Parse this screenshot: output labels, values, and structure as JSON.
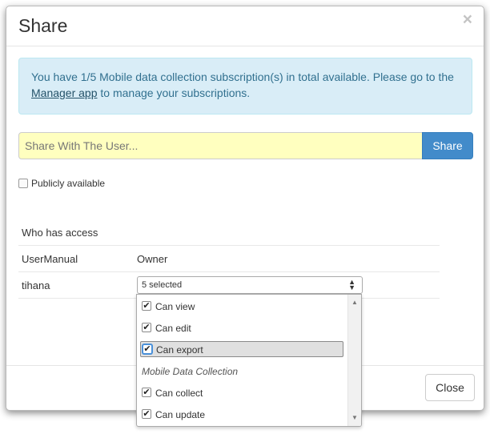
{
  "dialog": {
    "title": "Share",
    "close_symbol": "×"
  },
  "alert": {
    "text_before": "You have 1/5 Mobile data collection subscription(s) in total available. Please go to the ",
    "link": "Manager app",
    "text_after": " to manage your subscriptions."
  },
  "share": {
    "placeholder": "Share With The User...",
    "button_label": "Share"
  },
  "public": {
    "label": "Publicly available",
    "checked": false
  },
  "access": {
    "header": "Who has access",
    "rows": [
      {
        "user": "UserManual",
        "role": "Owner"
      },
      {
        "user": "tihana",
        "select_value": "5 selected"
      }
    ]
  },
  "dropdown": {
    "items": [
      {
        "label": "Can view",
        "checked": true
      },
      {
        "label": "Can edit",
        "checked": true
      },
      {
        "label": "Can export",
        "checked": true
      }
    ],
    "group_label": "Mobile Data Collection",
    "group_items": [
      {
        "label": "Can collect",
        "checked": true
      },
      {
        "label": "Can update",
        "checked": true
      }
    ],
    "check_symbol": "✔"
  },
  "footer": {
    "close_label": "Close"
  },
  "colors": {
    "primary": "#428bca",
    "alert_bg": "#d9edf7",
    "alert_text": "#31708f",
    "input_highlight": "#ffffbf"
  },
  "icons": [
    "close-icon",
    "checkbox-icon",
    "sort-arrows-icon",
    "scroll-up-icon",
    "scroll-down-icon"
  ]
}
